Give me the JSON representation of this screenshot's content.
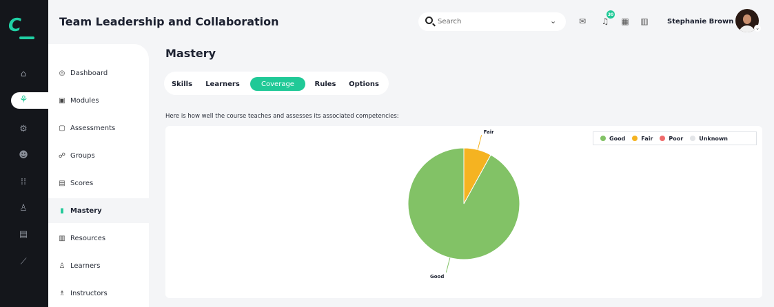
{
  "app": {
    "title": "Team Leadership and Collaboration"
  },
  "header": {
    "search_placeholder": "Search",
    "notification_count": "30",
    "user_name": "Stephanie Brown"
  },
  "sidebar": {
    "items": [
      {
        "label": "Dashboard",
        "icon": "dashboard-icon"
      },
      {
        "label": "Modules",
        "icon": "modules-icon"
      },
      {
        "label": "Assessments",
        "icon": "assessments-icon"
      },
      {
        "label": "Groups",
        "icon": "groups-icon"
      },
      {
        "label": "Scores",
        "icon": "scores-icon"
      },
      {
        "label": "Mastery",
        "icon": "mastery-icon",
        "active": true
      },
      {
        "label": "Resources",
        "icon": "resources-icon"
      },
      {
        "label": "Learners",
        "icon": "learners-icon"
      },
      {
        "label": "Instructors",
        "icon": "instructors-icon"
      }
    ]
  },
  "main": {
    "title": "Mastery",
    "tabs": [
      {
        "label": "Skills"
      },
      {
        "label": "Learners"
      },
      {
        "label": "Coverage",
        "active": true
      },
      {
        "label": "Rules"
      },
      {
        "label": "Options"
      }
    ],
    "description": "Here is how well the course teaches and assesses its associated competencies:"
  },
  "colors": {
    "accent": "#20c997",
    "good": "#82c266",
    "fair": "#f5b321",
    "poor": "#ef6b6b",
    "unknown": "#e3e5e8"
  },
  "chart_data": {
    "type": "pie",
    "categories": [
      "Good",
      "Fair",
      "Poor",
      "Unknown"
    ],
    "values": [
      92,
      8,
      0,
      0
    ],
    "legend": [
      {
        "label": "Good",
        "color": "#82c266"
      },
      {
        "label": "Fair",
        "color": "#f5b321"
      },
      {
        "label": "Poor",
        "color": "#ef6b6b"
      },
      {
        "label": "Unknown",
        "color": "#e3e5e8"
      }
    ],
    "legend_position": "top-right"
  }
}
